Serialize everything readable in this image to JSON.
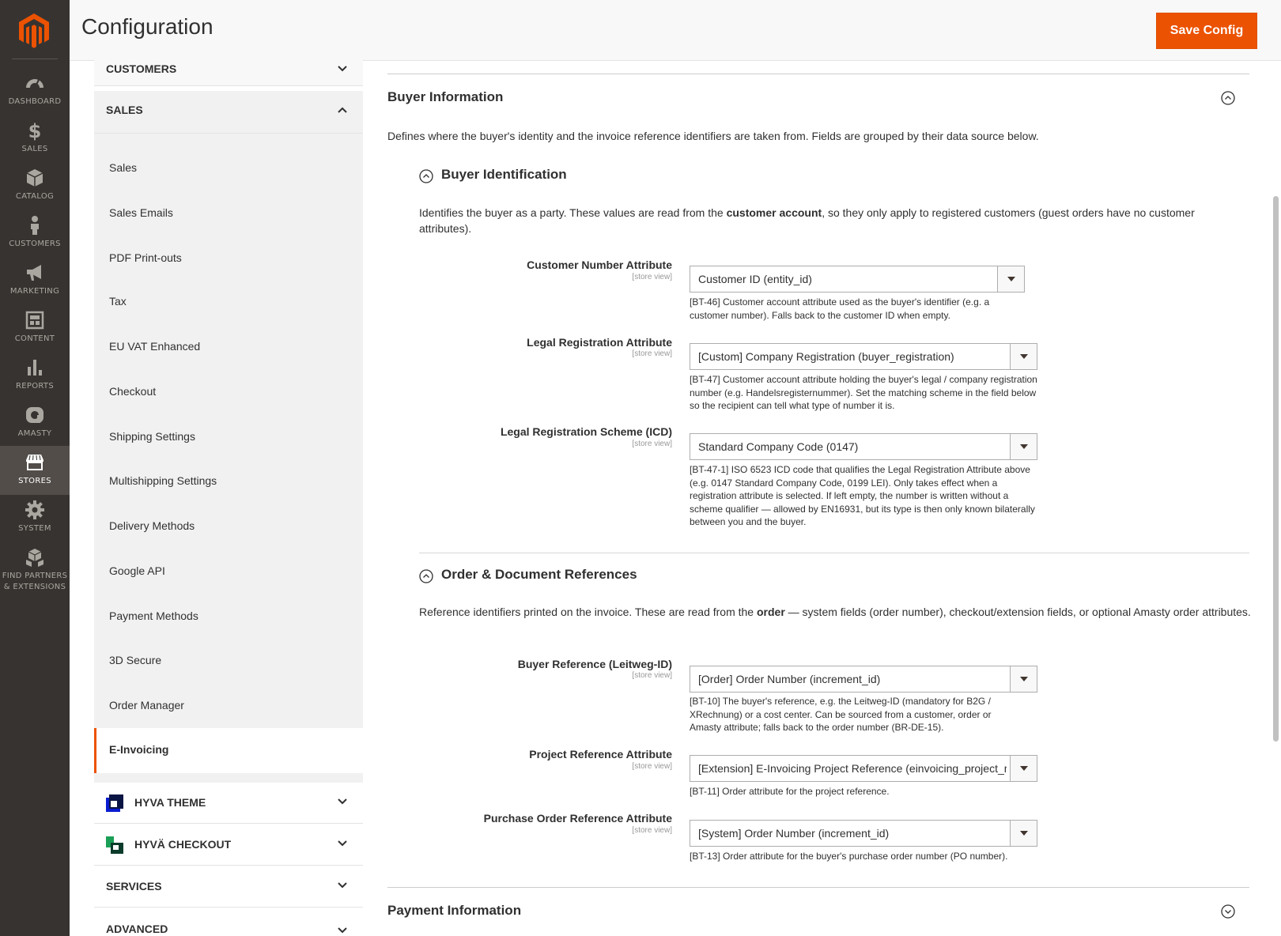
{
  "adminnav": {
    "items": [
      {
        "label": "DASHBOARD",
        "icon": "dashboard-icon"
      },
      {
        "label": "SALES",
        "icon": "dollar-icon"
      },
      {
        "label": "CATALOG",
        "icon": "box-icon"
      },
      {
        "label": "CUSTOMERS",
        "icon": "person-icon"
      },
      {
        "label": "MARKETING",
        "icon": "megaphone-icon"
      },
      {
        "label": "CONTENT",
        "icon": "layout-icon"
      },
      {
        "label": "REPORTS",
        "icon": "bar-chart-icon"
      },
      {
        "label": "AMASTY",
        "icon": "amasty-icon"
      },
      {
        "label": "STORES",
        "icon": "store-icon"
      },
      {
        "label": "SYSTEM",
        "icon": "gear-icon"
      },
      {
        "label": "FIND PARTNERS",
        "label2": "& EXTENSIONS",
        "icon": "cubes-icon"
      }
    ],
    "active": "STORES",
    "colors": {
      "bg": "#373330",
      "active_bg": "#524d49",
      "accent": "#eb5202"
    }
  },
  "header": {
    "title": "Configuration",
    "save_label": "Save Config"
  },
  "sidebar": {
    "customers": "CUSTOMERS",
    "sales": "SALES",
    "sales_items": [
      "Sales",
      "Sales Emails",
      "PDF Print-outs",
      "Tax",
      "EU VAT Enhanced",
      "Checkout",
      "Shipping Settings",
      "Multishipping Settings",
      "Delivery Methods",
      "Google API",
      "Payment Methods",
      "3D Secure",
      "Order Manager",
      "E-Invoicing"
    ],
    "active_item": "E-Invoicing",
    "hyva_theme": "HYVA THEME",
    "hyva_checkout": "HYVÄ CHECKOUT",
    "services": "SERVICES",
    "advanced": "ADVANCED"
  },
  "main": {
    "buyer_info": {
      "title": "Buyer Information",
      "desc": "Defines where the buyer's identity and the invoice reference identifiers are taken from. Fields are grouped by their data source below."
    },
    "buyer_ident": {
      "title": "Buyer Identification",
      "desc_a": "Identifies the buyer as a party. These values are read from the ",
      "desc_b": "customer account",
      "desc_c": ", so they only apply to registered customers (guest orders have no customer attributes).",
      "fields": [
        {
          "label": "Customer Number Attribute",
          "scope": "[store view]",
          "value": "Customer ID (entity_id)",
          "note": "[BT-46] Customer account attribute used as the buyer's identifier (e.g. a customer number). Falls back to the customer ID when empty."
        },
        {
          "label": "Legal Registration Attribute",
          "scope": "[store view]",
          "value": "[Custom] Company Registration (buyer_registration)",
          "note": "[BT-47] Customer account attribute holding the buyer's legal / company registration number (e.g. Handelsregisternummer). Set the matching scheme in the field below so the recipient can tell what type of number it is."
        },
        {
          "label": "Legal Registration Scheme (ICD)",
          "scope": "[store view]",
          "value": "Standard Company Code (0147)",
          "note": "[BT-47-1] ISO 6523 ICD code that qualifies the Legal Registration Attribute above (e.g. 0147 Standard Company Code, 0199 LEI). Only takes effect when a registration attribute is selected. If left empty, the number is written without a scheme qualifier — allowed by EN16931, but its type is then only known bilaterally between you and the buyer."
        }
      ]
    },
    "order_refs": {
      "title": "Order & Document References",
      "desc_a": "Reference identifiers printed on the invoice. These are read from the ",
      "desc_b": "order",
      "desc_c": " — system fields (order number), checkout/extension fields, or optional Amasty order attributes.",
      "fields": [
        {
          "label": "Buyer Reference (Leitweg-ID)",
          "scope": "[store view]",
          "value": "[Order] Order Number (increment_id)",
          "note": "[BT-10] The buyer's reference, e.g. the Leitweg-ID (mandatory for B2G / XRechnung) or a cost center. Can be sourced from a customer, order or Amasty attribute; falls back to the order number (BR-DE-15)."
        },
        {
          "label": "Project Reference Attribute",
          "scope": "[store view]",
          "value": "[Extension] E-Invoicing Project Reference (einvoicing_project_reference)",
          "note": "[BT-11] Order attribute for the project reference."
        },
        {
          "label": "Purchase Order Reference Attribute",
          "scope": "[store view]",
          "value": "[System] Order Number (increment_id)",
          "note": "[BT-13] Order attribute for the buyer's purchase order number (PO number)."
        }
      ]
    },
    "payment_info": {
      "title": "Payment Information"
    }
  }
}
